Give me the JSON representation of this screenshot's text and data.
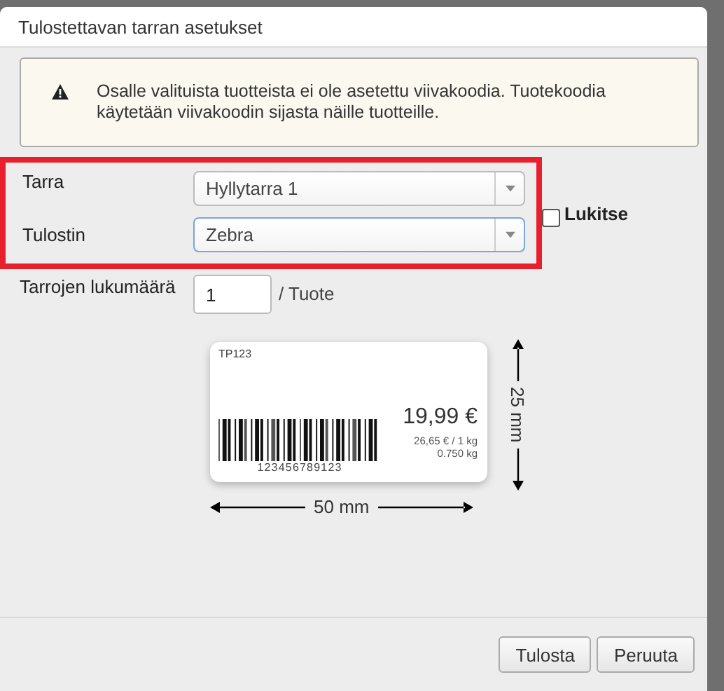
{
  "dialog": {
    "title": "Tulostettavan tarran asetukset"
  },
  "alert": {
    "text": "Osalle valituista tuotteista ei ole asetettu viivakoodia. Tuotekoodia käytetään viivakoodin sijasta näille tuotteille."
  },
  "highlighted": true,
  "fields": [
    {
      "kind": "select",
      "label": "Tarra",
      "value": "Hyllytarra 1",
      "focused": false
    },
    {
      "kind": "select",
      "label": "Tulostin",
      "value": "Zebra",
      "focused": true
    }
  ],
  "lock": {
    "label": "Lukitse",
    "checked": false
  },
  "count": {
    "label": "Tarrojen lukumäärä",
    "value": "1",
    "unit": "/ Tuote"
  },
  "preview": {
    "code": "TP123",
    "price": "19,99 €",
    "unit_price": "26,65 € / 1 kg",
    "weight": "0.750 kg",
    "barcode_number": "123456789123",
    "width": "50 mm",
    "height": "25 mm"
  },
  "buttons": [
    {
      "label": "Tulosta"
    },
    {
      "label": "Peruuta"
    }
  ]
}
